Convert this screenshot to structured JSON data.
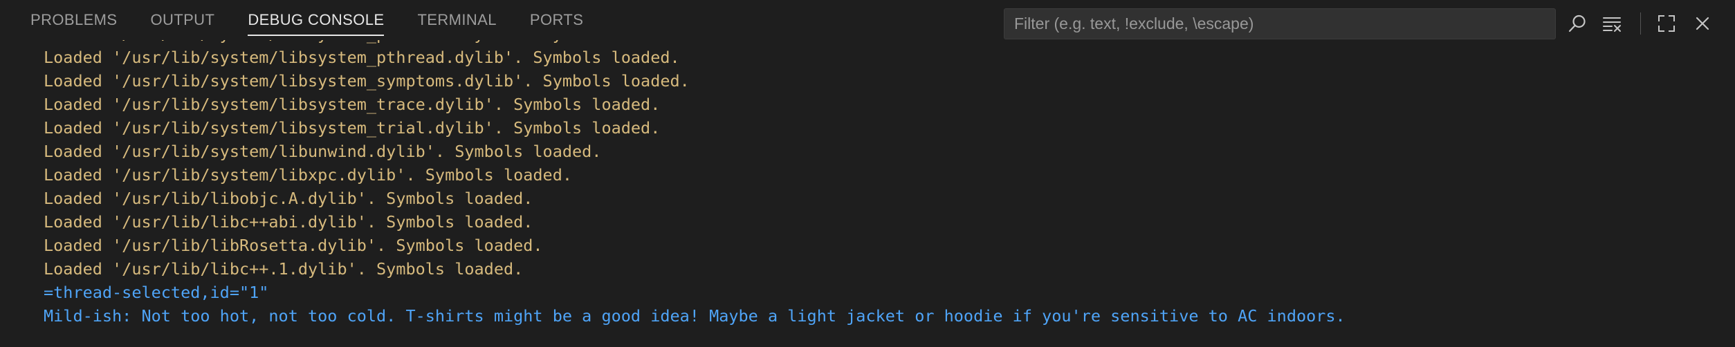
{
  "tabs": [
    {
      "label": "PROBLEMS",
      "active": false
    },
    {
      "label": "OUTPUT",
      "active": false
    },
    {
      "label": "DEBUG CONSOLE",
      "active": true
    },
    {
      "label": "TERMINAL",
      "active": false
    },
    {
      "label": "PORTS",
      "active": false
    }
  ],
  "filter": {
    "placeholder": "Filter (e.g. text, !exclude, \\escape)",
    "value": ""
  },
  "icons": {
    "search": "search-icon",
    "clear_console": "clear-console-icon",
    "maximize": "maximize-icon",
    "close": "close-icon"
  },
  "colors": {
    "background": "#1e1e1e",
    "log_text": "#d7ba7d",
    "output_text": "#4fa4f7",
    "tab_inactive": "#9d9d9d",
    "tab_active": "#e7e7e7"
  },
  "console": {
    "lines": [
      {
        "text": "Loaded '/usr/lib/system/libsystem_platform.dylib'. Symbols loaded.",
        "kind": "info"
      },
      {
        "text": "Loaded '/usr/lib/system/libsystem_pthread.dylib'. Symbols loaded.",
        "kind": "info"
      },
      {
        "text": "Loaded '/usr/lib/system/libsystem_symptoms.dylib'. Symbols loaded.",
        "kind": "info"
      },
      {
        "text": "Loaded '/usr/lib/system/libsystem_trace.dylib'. Symbols loaded.",
        "kind": "info"
      },
      {
        "text": "Loaded '/usr/lib/system/libsystem_trial.dylib'. Symbols loaded.",
        "kind": "info"
      },
      {
        "text": "Loaded '/usr/lib/system/libunwind.dylib'. Symbols loaded.",
        "kind": "info"
      },
      {
        "text": "Loaded '/usr/lib/system/libxpc.dylib'. Symbols loaded.",
        "kind": "info"
      },
      {
        "text": "Loaded '/usr/lib/libobjc.A.dylib'. Symbols loaded.",
        "kind": "info"
      },
      {
        "text": "Loaded '/usr/lib/libc++abi.dylib'. Symbols loaded.",
        "kind": "info"
      },
      {
        "text": "Loaded '/usr/lib/libRosetta.dylib'. Symbols loaded.",
        "kind": "info"
      },
      {
        "text": "Loaded '/usr/lib/libc++.1.dylib'. Symbols loaded.",
        "kind": "info"
      },
      {
        "text": "=thread-selected,id=\"1\"",
        "kind": "output"
      },
      {
        "text": "Mild-ish: Not too hot, not too cold. T-shirts might be a good idea! Maybe a light jacket or hoodie if you're sensitive to AC indoors.",
        "kind": "output"
      }
    ]
  }
}
